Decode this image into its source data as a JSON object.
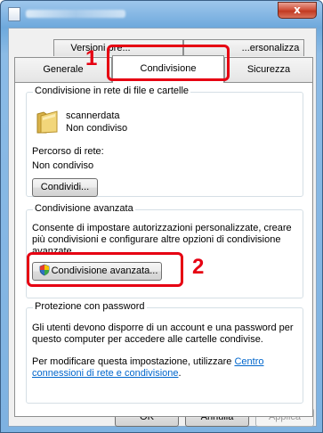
{
  "window": {
    "close_label": "x"
  },
  "tabs": {
    "row_back": [
      {
        "label": "Versioni pre..."
      },
      {
        "label": "...ersonalizza"
      }
    ],
    "row_front": [
      {
        "label": "Generale"
      },
      {
        "label": "Condivisione"
      },
      {
        "label": "Sicurezza"
      }
    ]
  },
  "network_sharing": {
    "legend": "Condivisione in rete di file e cartelle",
    "folder_name": "scannerdata",
    "folder_status": "Non condiviso",
    "path_label": "Percorso di rete:",
    "path_value": "Non condiviso",
    "share_button": "Condividi..."
  },
  "advanced_sharing": {
    "legend": "Condivisione avanzata",
    "description": "Consente di impostare autorizzazioni personalizzate, creare più condivisioni e configurare altre opzioni di condivisione avanzate.",
    "button": "Condivisione avanzata..."
  },
  "password_protection": {
    "legend": "Protezione con password",
    "description": "Gli utenti devono disporre di un account e una password per questo computer per accedere alle cartelle condivise.",
    "change_prefix": "Per modificare questa impostazione, utilizzare",
    "link_text": "Centro connessioni di rete e condivisione",
    "link_suffix": "."
  },
  "footer": {
    "ok": "OK",
    "cancel": "Annulla",
    "apply": "Applica"
  },
  "callouts": [
    {
      "number": "1"
    },
    {
      "number": "2"
    }
  ],
  "colors": {
    "callout": "#e60012",
    "link": "#0066cc"
  }
}
